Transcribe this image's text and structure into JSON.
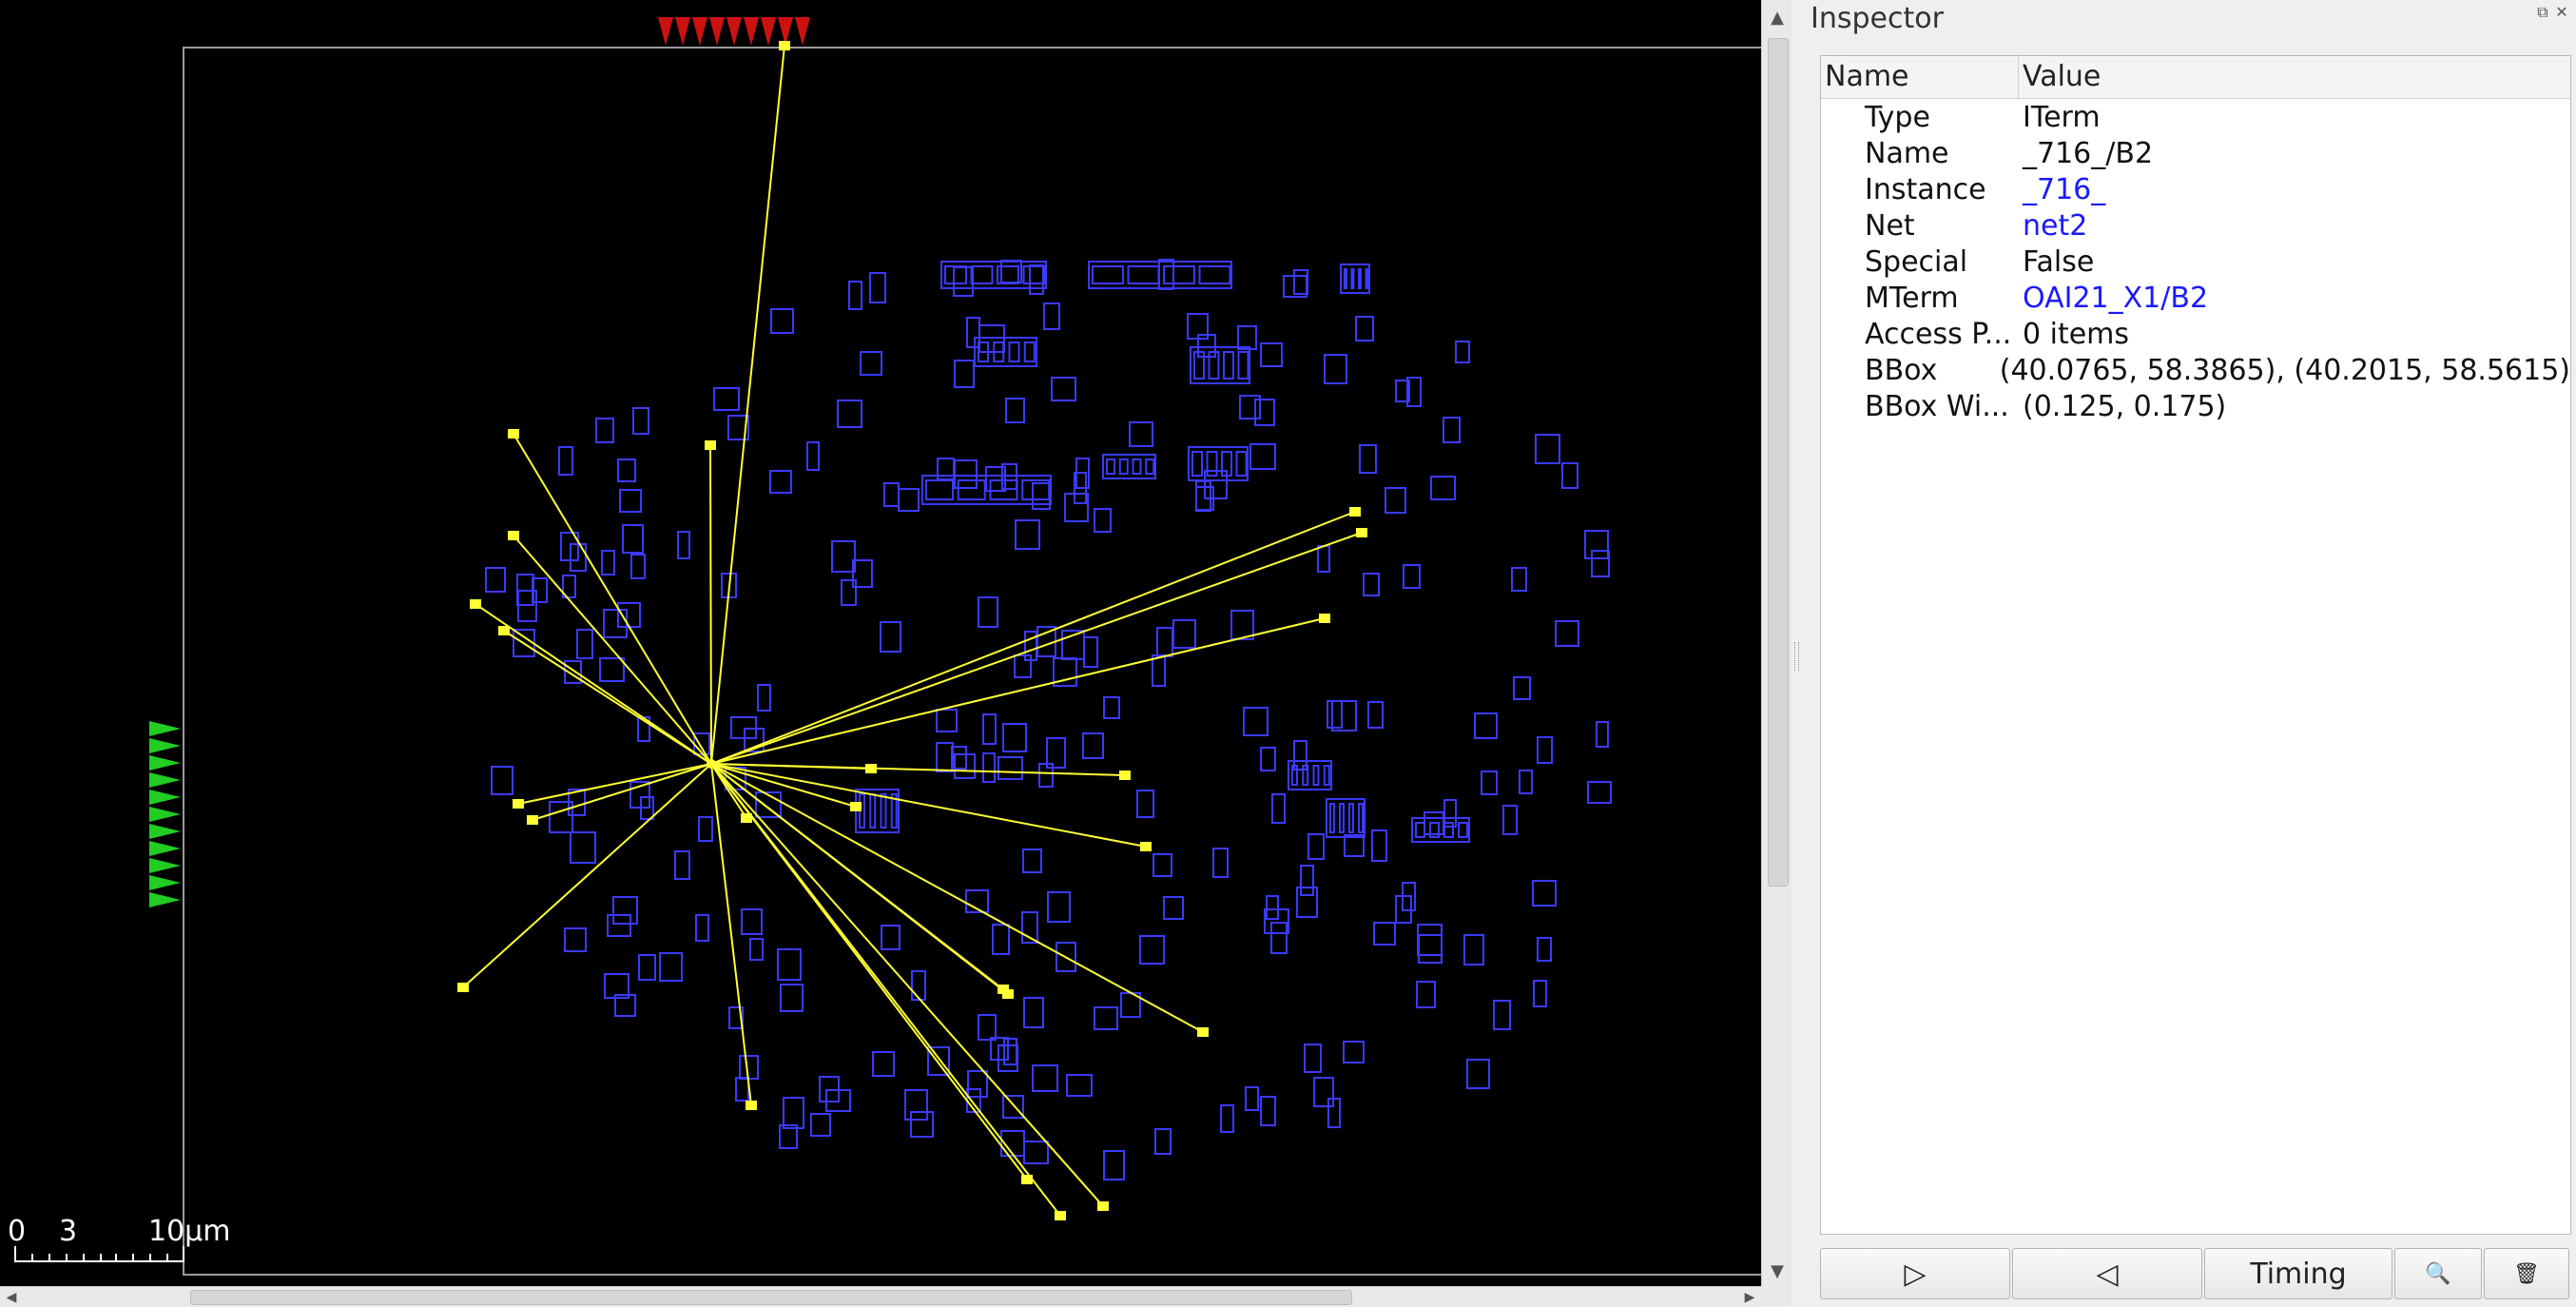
{
  "layout_view": {
    "scale_bar": {
      "label_0": "0",
      "label_3": "3",
      "label_10": "10μm"
    }
  },
  "inspector": {
    "title": "Inspector",
    "columns": {
      "name": "Name",
      "value": "Value"
    },
    "rows": [
      {
        "name": "Type",
        "value": "ITerm",
        "link": false
      },
      {
        "name": "Name",
        "value": "_716_/B2",
        "link": false
      },
      {
        "name": "Instance",
        "value": "_716_",
        "link": true
      },
      {
        "name": "Net",
        "value": "net2",
        "link": true
      },
      {
        "name": "Special",
        "value": "False",
        "link": false
      },
      {
        "name": "MTerm",
        "value": "OAI21_X1/B2",
        "link": true
      },
      {
        "name": "Access P...",
        "value": "0 items",
        "link": false
      },
      {
        "name": "BBox",
        "value": "(40.0765, 58.3865), (40.2015, 58.5615)",
        "link": false
      },
      {
        "name": "BBox Wi...",
        "value": "(0.125, 0.175)",
        "link": false
      }
    ],
    "buttons": {
      "next_icon": "▷",
      "prev_icon": "◁",
      "timing": "Timing",
      "zoom_icon": "🔍",
      "delete_icon": "🗑"
    }
  },
  "colors": {
    "background": "#000000",
    "cells": "#3535ff",
    "flylines": "#ffff33",
    "pins_top": "#cc1111",
    "pins_left": "#22cc22"
  }
}
